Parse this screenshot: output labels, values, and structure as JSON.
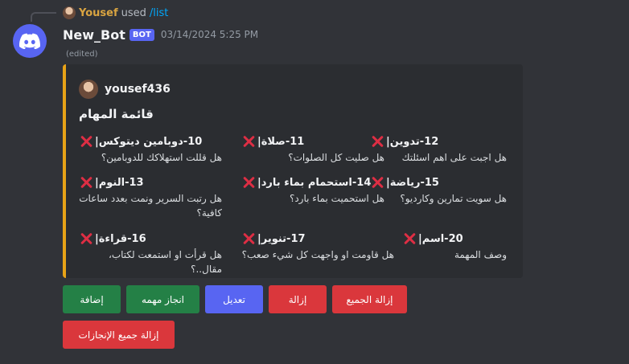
{
  "reference": {
    "user": "Yousef",
    "used": "used",
    "command": "/list"
  },
  "message": {
    "bot_name": "New_Bot",
    "bot_tag": "BOT",
    "timestamp": "03/14/2024 5:25 PM",
    "edited": "(edited)"
  },
  "embed": {
    "author": "yousef436",
    "title": "قائمة المهام",
    "accent_color": "#e8a317",
    "fields": [
      {
        "name": "10-دوبامين ديتوكس|",
        "status_icon": "cross-mark-icon",
        "value": "هل قللت استهلاكك للدوبامين؟"
      },
      {
        "name": "11-صلاة|",
        "status_icon": "cross-mark-icon",
        "value": "هل صليت كل الصلوات؟"
      },
      {
        "name": "12-تدوين|",
        "status_icon": "cross-mark-icon",
        "value": "هل اجبت على اهم اسئلتك"
      },
      {
        "name": "13-النوم|",
        "status_icon": "cross-mark-icon",
        "value": "هل رتبت السرير ونمت بعدد ساعات كافية؟"
      },
      {
        "name": "14-استحمام بماء بارد|",
        "status_icon": "cross-mark-icon",
        "value": "هل استحميت بماء بارد؟"
      },
      {
        "name": "15-رياضة|",
        "status_icon": "cross-mark-icon",
        "value": "هل سويت تمارين وكارديو؟"
      },
      {
        "name": "16-قراءة|",
        "status_icon": "cross-mark-icon",
        "value": "هل قرأت او استمعت لكتاب، مقال..؟"
      },
      {
        "name": "17-تنوير|",
        "status_icon": "cross-mark-icon",
        "value": "هل قاومت او واجهت كل شيء صعب؟"
      },
      {
        "name": "20-اسم|",
        "status_icon": "cross-mark-icon",
        "value": "وصف المهمة"
      }
    ]
  },
  "buttons": {
    "add": "إضافة",
    "complete": "انجاز مهمه",
    "edit": "تعديل",
    "remove": "إزالة",
    "remove_all": "إزالة الجميع",
    "remove_all_achievements": "إزالة جميع الإنجازات"
  },
  "colors": {
    "background": "#313338",
    "green": "#248046",
    "blurple": "#5865f2",
    "red": "#da373c"
  }
}
